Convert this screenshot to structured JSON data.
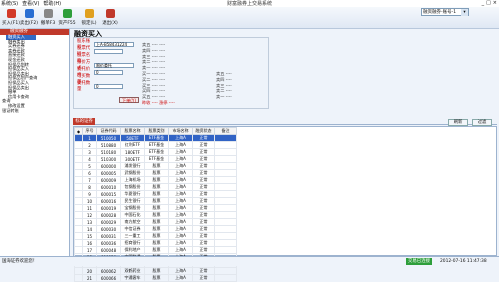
{
  "menubar": {
    "items": [
      "系统(S)",
      "查看(V)",
      "帮助(H)"
    ],
    "app_title": "财富融券上交易系统",
    "win_controls": [
      "_",
      "□",
      "×"
    ]
  },
  "toolbar": {
    "buttons": [
      {
        "label": "买入(F1)",
        "icon": "buy-icon",
        "color": "#d23a2a"
      },
      {
        "label": "卖出(F2)",
        "icon": "sell-icon",
        "color": "#2a6fd2"
      },
      {
        "label": "撤单F3",
        "icon": "cancel-order-icon",
        "color": "#888888"
      },
      {
        "label": "资产F55",
        "icon": "assets-icon",
        "color": "#2e9e3b"
      },
      {
        "label": "锁定(L)",
        "icon": "lock-icon",
        "color": "#e0a020"
      },
      {
        "label": "退出(X)",
        "icon": "exit-icon",
        "color": "#c0392b"
      }
    ],
    "account_combo": "融资融券-账号-1"
  },
  "sidebar": {
    "header": "融资融券",
    "items": [
      {
        "label": "融资买入",
        "selected": true,
        "level": 1
      },
      {
        "label": "融券卖出",
        "level": 1
      },
      {
        "label": "买券还券",
        "level": 1
      },
      {
        "label": "卖券还款",
        "level": 1
      },
      {
        "label": "直接还款",
        "level": 1
      },
      {
        "label": "现金还款",
        "level": 1
      },
      {
        "label": "担保品划转",
        "level": 1
      },
      {
        "label": "担保品买入",
        "level": 1
      },
      {
        "label": "担保品卖出",
        "level": 1
      },
      {
        "label": "担保品划户查询",
        "level": 1
      },
      {
        "label": "担保品买入",
        "level": 1
      },
      {
        "label": "担保品卖出",
        "level": 1
      },
      {
        "label": "撤单",
        "level": 1
      },
      {
        "label": "信用卡查询",
        "level": 1
      },
      {
        "label": "查询",
        "level": 0
      },
      {
        "label": "修改设置",
        "level": 1
      },
      {
        "label": "银证转账",
        "level": 0
      }
    ]
  },
  "main": {
    "title": "融资买入",
    "form": {
      "account_label": "股东账号",
      "account_value": "上A-B58431224",
      "code_label": "股票代码",
      "code_value": "",
      "name_label": "股票名称",
      "name_value": "",
      "pricetype_label": "报价方式",
      "pricetype_value": "限价委托",
      "price_label": "委托价格",
      "price_value": "0",
      "available_label": "可买数量",
      "available_value": "",
      "qty_label": "委托数量",
      "qty_value": "0",
      "order_button": "下单(Y)"
    },
    "quotes": {
      "sell": [
        "卖五 ---- ----",
        "卖四 ---- ----",
        "卖三 ---- ----",
        "卖二 ---- ----",
        "卖一 ---- ----"
      ],
      "buy": [
        "买一 ---- ----",
        "买二 ---- ----",
        "买三 ---- ----",
        "买四 ---- ----",
        "买五 ---- ----"
      ],
      "right_top": [
        "卖五 ----",
        "卖四 ----",
        "卖三 ----",
        "卖二 ----",
        "卖一 ----"
      ],
      "right_bottom": [
        "买一 ----",
        "买二 ----",
        "买三 ----",
        "买四 ----",
        "买五 ----"
      ],
      "extra": [
        "昨收 ---- 涨停 ----",
        "今开 ---- 跌停 ----"
      ]
    },
    "tab": "标的证券",
    "refresh_button": "刷新",
    "filter_button": "过滤",
    "table": {
      "columns": [
        "序号",
        "证券代码",
        "股票名称",
        "股票类别",
        "市场名称",
        "融资状态",
        "备注"
      ],
      "rows": [
        [
          "1",
          "510050",
          "50ETF",
          "ETF基金",
          "上海A",
          "正常",
          ""
        ],
        [
          "2",
          "510880",
          "红利ETF",
          "ETF基金",
          "上海A",
          "正常",
          ""
        ],
        [
          "3",
          "510180",
          "180ETF",
          "ETF基金",
          "上海A",
          "正常",
          ""
        ],
        [
          "4",
          "510300",
          "300ETF",
          "ETF基金",
          "上海A",
          "正常",
          ""
        ],
        [
          "5",
          "600000",
          "浦发银行",
          "股票",
          "上海A",
          "正常",
          ""
        ],
        [
          "6",
          "600005",
          "武钢股份",
          "股票",
          "上海A",
          "正常",
          ""
        ],
        [
          "7",
          "600009",
          "上海机场",
          "股票",
          "上海A",
          "正常",
          ""
        ],
        [
          "8",
          "600010",
          "包钢股份",
          "股票",
          "上海A",
          "正常",
          ""
        ],
        [
          "9",
          "600015",
          "华夏银行",
          "股票",
          "上海A",
          "正常",
          ""
        ],
        [
          "10",
          "600016",
          "民生银行",
          "股票",
          "上海A",
          "正常",
          ""
        ],
        [
          "11",
          "600019",
          "宝钢股份",
          "股票",
          "上海A",
          "正常",
          ""
        ],
        [
          "12",
          "600028",
          "中国石化",
          "股票",
          "上海A",
          "正常",
          ""
        ],
        [
          "13",
          "600029",
          "南方航空",
          "股票",
          "上海A",
          "正常",
          ""
        ],
        [
          "14",
          "600030",
          "中信证券",
          "股票",
          "上海A",
          "正常",
          ""
        ],
        [
          "15",
          "600031",
          "三一重工",
          "股票",
          "上海A",
          "正常",
          ""
        ],
        [
          "16",
          "600036",
          "招商银行",
          "股票",
          "上海A",
          "正常",
          ""
        ],
        [
          "17",
          "600048",
          "保利地产",
          "股票",
          "上海A",
          "正常",
          ""
        ],
        [
          "18",
          "600050",
          "中国联通",
          "股票",
          "上海A",
          "正常",
          ""
        ],
        [
          "19",
          "600058",
          "五矿发展",
          "股票",
          "上海A",
          "正常",
          ""
        ],
        [
          "20",
          "600062",
          "双鹤药业",
          "股票",
          "上海A",
          "正常",
          ""
        ],
        [
          "21",
          "600066",
          "宇通客车",
          "股票",
          "上海A",
          "正常",
          ""
        ]
      ]
    }
  },
  "status": {
    "left": "国海证券欢迎您！",
    "connection": "交易已连接",
    "time": "2012-07-16 11:47:38"
  }
}
